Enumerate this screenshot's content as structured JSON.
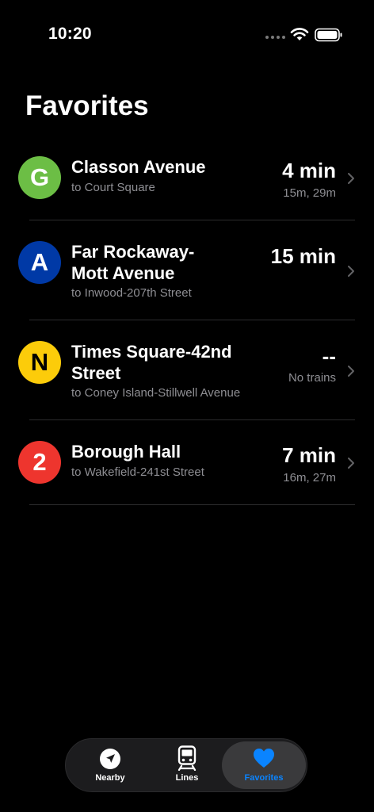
{
  "status_bar": {
    "time": "10:20"
  },
  "page": {
    "title": "Favorites"
  },
  "favorites": [
    {
      "line": "G",
      "line_color": "#6cbe45",
      "line_text_color": "#ffffff",
      "station_lines": [
        "Classon Avenue"
      ],
      "direction": "to Court Square",
      "eta": "4 min",
      "next": "15m, 29m"
    },
    {
      "line": "A",
      "line_color": "#0039a6",
      "line_text_color": "#ffffff",
      "station_lines": [
        "Far Rockaway-",
        "Mott Avenue"
      ],
      "direction": "to Inwood-207th Street",
      "eta": "15 min",
      "next": ""
    },
    {
      "line": "N",
      "line_color": "#fccc0a",
      "line_text_color": "#000000",
      "station_lines": [
        "Times Square-42nd",
        "Street"
      ],
      "direction": "to Coney Island-Stillwell Avenue",
      "eta": "--",
      "next": "No trains"
    },
    {
      "line": "2",
      "line_color": "#ee352e",
      "line_text_color": "#ffffff",
      "station_lines": [
        "Borough Hall"
      ],
      "direction": "to Wakefield-241st Street",
      "eta": "7 min",
      "next": "16m, 27m"
    }
  ],
  "tab_bar": {
    "accent_color": "#0a84ff",
    "tabs": [
      {
        "label": "Nearby",
        "icon": "location-arrow-icon",
        "active": false
      },
      {
        "label": "Lines",
        "icon": "train-icon",
        "active": false
      },
      {
        "label": "Favorites",
        "icon": "heart-icon",
        "active": true
      }
    ]
  }
}
